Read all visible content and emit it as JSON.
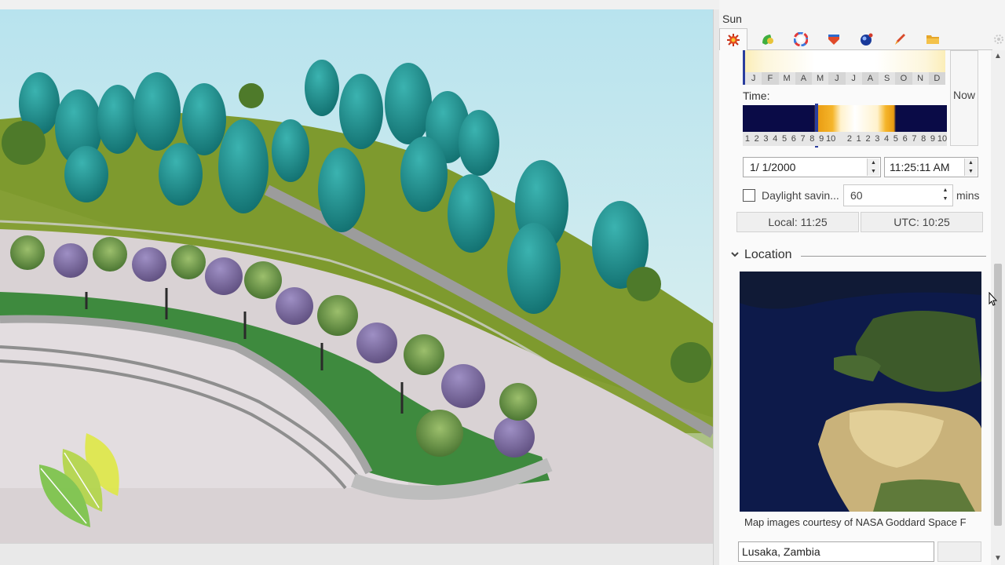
{
  "panel": {
    "title": "Sun",
    "tabs": [
      {
        "name": "sun-tab",
        "icon": "sun-icon",
        "active": true
      },
      {
        "name": "environment-tab",
        "icon": "leaf-icon"
      },
      {
        "name": "color-tab",
        "icon": "color-wheel-icon"
      },
      {
        "name": "material-tab",
        "icon": "material-icon"
      },
      {
        "name": "render-tab",
        "icon": "sphere-icon"
      },
      {
        "name": "paint-tab",
        "icon": "brush-icon"
      },
      {
        "name": "files-tab",
        "icon": "folder-icon"
      }
    ]
  },
  "sun": {
    "months": [
      "J",
      "F",
      "M",
      "A",
      "M",
      "J",
      "J",
      "A",
      "S",
      "O",
      "N",
      "D"
    ],
    "now_label": "Now",
    "time_label": "Time:",
    "hours": [
      "1",
      "2",
      "3",
      "4",
      "5",
      "6",
      "7",
      "8",
      "9",
      "10",
      "",
      "2",
      "1",
      "2",
      "3",
      "4",
      "5",
      "6",
      "7",
      "8",
      "9",
      "10"
    ],
    "date_value": "1/  1/2000",
    "time_value": "11:25:11 AM",
    "daylight_saving_label": "Daylight savin...",
    "daylight_saving_checked": false,
    "dst_offset_value": "60",
    "dst_offset_unit": "mins",
    "local_time": "Local: 11:25",
    "utc_time": "UTC: 10:25"
  },
  "location": {
    "title": "Location",
    "map_credit": "Map images courtesy of NASA Goddard Space F",
    "city_value": "Lusaka, Zambia"
  },
  "colors": {
    "night": "#0a0b47",
    "day_orange": "#e89a10",
    "marker_blue": "#2b3e9e",
    "sky": "#c9e8ef",
    "grass": "#7e9a2e"
  }
}
